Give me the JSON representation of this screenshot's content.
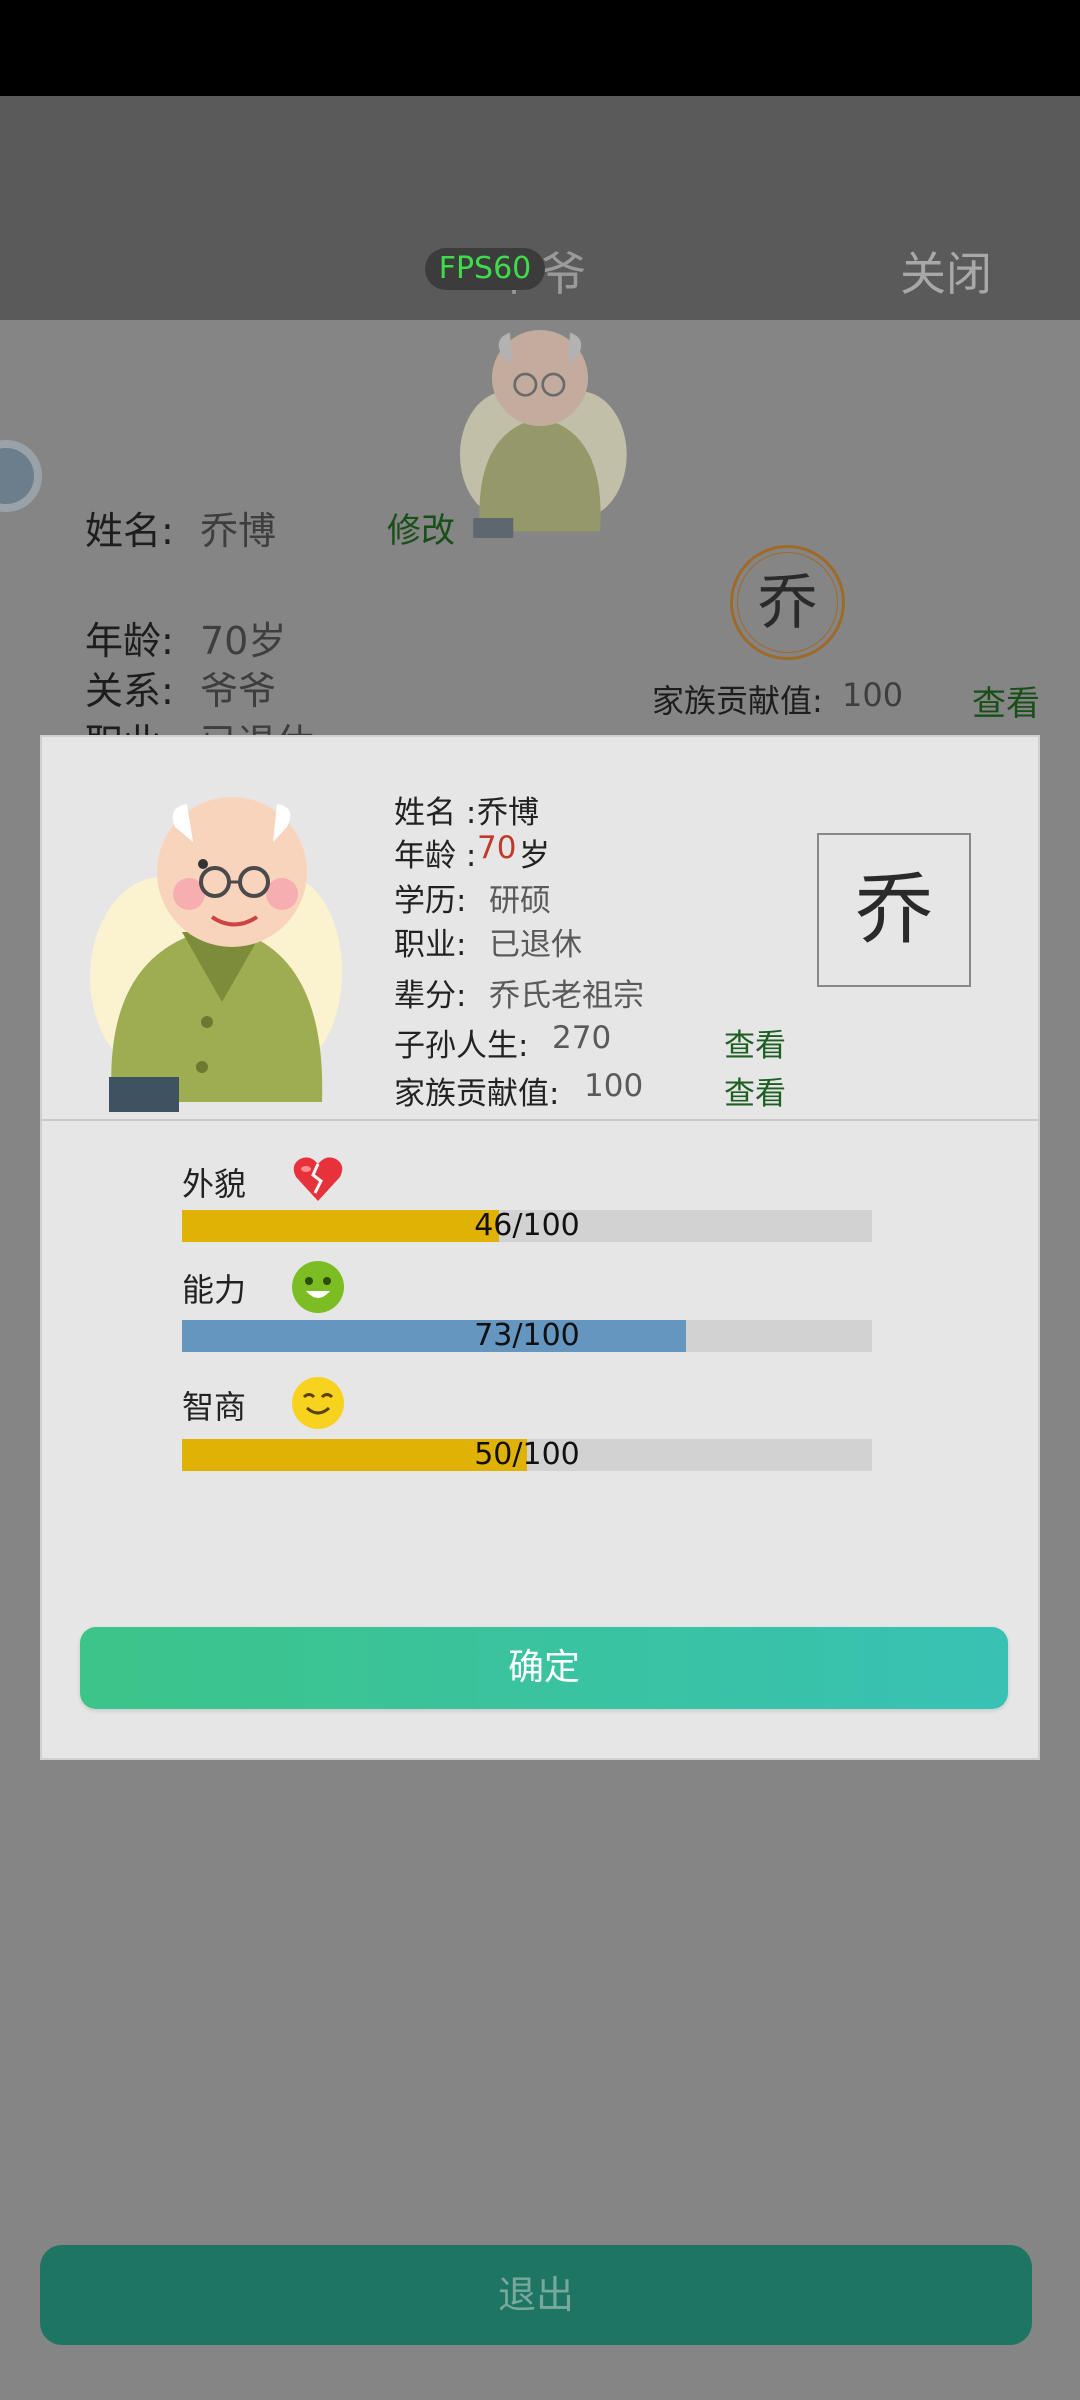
{
  "header": {
    "title": "爷爷",
    "fps": "FPS60",
    "close_label": "关闭"
  },
  "background": {
    "name_label": "姓名:",
    "name_value": "乔博",
    "edit_link": "修改",
    "age_label": "年龄:",
    "age_value": "70岁",
    "relation_label": "关系:",
    "relation_value": "爷爷",
    "job_label": "职业:",
    "job_value": "已退休",
    "seal_char": "乔",
    "contribution_label": "家族贡献值:",
    "contribution_value": "100",
    "view_link": "查看",
    "exit_label": "退出"
  },
  "modal": {
    "name_label": "姓名 :",
    "name_value": "乔博",
    "age_label": "年龄 :",
    "age_value": "70",
    "age_unit": "岁",
    "education_label": "学历:",
    "education_value": "研硕",
    "job_label": "职业:",
    "job_value": "已退休",
    "generation_label": "辈分:",
    "generation_value": "乔氏老祖宗",
    "descendants_label": "子孙人生:",
    "descendants_value": "270",
    "descendants_link": "查看",
    "contribution_label": "家族贡献值:",
    "contribution_value": "100",
    "contribution_link": "查看",
    "surname_char": "乔",
    "stats": [
      {
        "label": "外貌",
        "value": 46,
        "max": 100,
        "text": "46/100",
        "color": "#e1b206",
        "icon": "broken-heart-icon"
      },
      {
        "label": "能力",
        "value": 73,
        "max": 100,
        "text": "73/100",
        "color": "#6496bf",
        "icon": "green-face-icon"
      },
      {
        "label": "智商",
        "value": 50,
        "max": 100,
        "text": "50/100",
        "color": "#e1b206",
        "icon": "smiling-face-icon"
      }
    ],
    "confirm_label": "确定"
  }
}
